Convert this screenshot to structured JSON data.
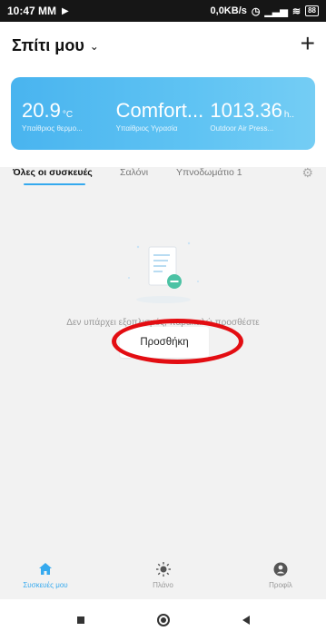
{
  "status_bar": {
    "time": "10:47 MM",
    "speed": "0,0KB/s",
    "battery": "88"
  },
  "header": {
    "home_title": "Σπίτι μου",
    "add_icon": "plus-icon"
  },
  "weather": [
    {
      "value": "20.9",
      "unit": "°C",
      "label": "Υπαίθριος θερμο..."
    },
    {
      "value": "Comfort...",
      "unit": "",
      "label": "Υπαίθριος Υγρασία"
    },
    {
      "value": "1013.36",
      "unit": "h..",
      "label": "Outdoor Air Press..."
    }
  ],
  "tabs": {
    "items": [
      "Όλες οι συσκευές",
      "Σαλόνι",
      "Υπνοδωμάτιο 1"
    ],
    "active_index": 0
  },
  "empty_state": {
    "message": "Δεν υπάρχει εξοπλισμός, παρακαλώ προσθέστε",
    "add_button": "Προσθήκη"
  },
  "bottom_nav": [
    {
      "label": "Συσκευές μου",
      "icon": "home-icon",
      "active": true
    },
    {
      "label": "Πλάνο",
      "icon": "sun-icon",
      "active": false
    },
    {
      "label": "Προφίλ",
      "icon": "profile-icon",
      "active": false
    }
  ],
  "colors": {
    "accent": "#35a9ee",
    "weather_card": "#4fb8f0",
    "highlight": "#e30d12"
  }
}
